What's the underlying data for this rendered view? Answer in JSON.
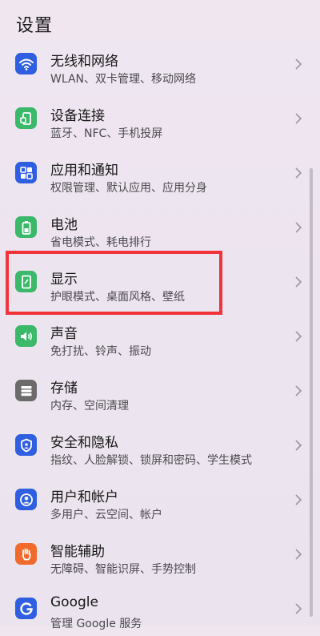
{
  "header": {
    "title": "设置"
  },
  "settings": {
    "items": [
      {
        "title": "无线和网络",
        "subtitle": "WLAN、双卡管理、移动网络",
        "icon": "wifi-icon",
        "color": "#2f5ee0"
      },
      {
        "title": "设备连接",
        "subtitle": "蓝牙、NFC、手机投屏",
        "icon": "device-link-icon",
        "color": "#3bb86a"
      },
      {
        "title": "应用和通知",
        "subtitle": "权限管理、默认应用、应用分身",
        "icon": "apps-icon",
        "color": "#2f5ee0"
      },
      {
        "title": "电池",
        "subtitle": "省电模式、耗电排行",
        "icon": "battery-icon",
        "color": "#3bb86a"
      },
      {
        "title": "显示",
        "subtitle": "护眼模式、桌面风格、壁纸",
        "icon": "display-icon",
        "color": "#3bb86a"
      },
      {
        "title": "声音",
        "subtitle": "免打扰、铃声、振动",
        "icon": "sound-icon",
        "color": "#3bb86a"
      },
      {
        "title": "存储",
        "subtitle": "内存、空间清理",
        "icon": "storage-icon",
        "color": "#6b6b6b"
      },
      {
        "title": "安全和隐私",
        "subtitle": "指纹、人脸解锁、锁屏和密码、学生模式",
        "icon": "shield-icon",
        "color": "#2f5ee0"
      },
      {
        "title": "用户和帐户",
        "subtitle": "多用户、云空间、帐户",
        "icon": "user-icon",
        "color": "#2f5ee0"
      },
      {
        "title": "智能辅助",
        "subtitle": "无障碍、智能识屏、手势控制",
        "icon": "hand-icon",
        "color": "#f06a2c"
      },
      {
        "title": "Google",
        "subtitle": "管理 Google 服务",
        "icon": "google-icon",
        "color": "#2f5ee0"
      }
    ]
  },
  "colors": {
    "highlight": "#f2333a",
    "background": "#ece4ef"
  }
}
